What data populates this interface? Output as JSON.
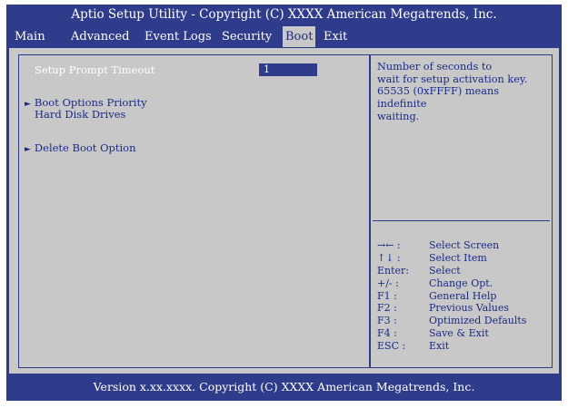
{
  "header": {
    "title": "Aptio Setup Utility - Copyright (C) XXXX American Megatrends, Inc."
  },
  "tabs": [
    {
      "label": "Main"
    },
    {
      "label": "Advanced"
    },
    {
      "label": "Event Logs"
    },
    {
      "label": "Security"
    },
    {
      "label": "Boot",
      "active": true
    },
    {
      "label": "Exit"
    }
  ],
  "main": {
    "setup_prompt_timeout": {
      "label": "Setup Prompt Timeout",
      "value": "1"
    },
    "boot_options_priority": {
      "label": "Boot Options Priority"
    },
    "hard_disk_drives": {
      "label": "Hard Disk Drives"
    },
    "delete_boot_option": {
      "label": "Delete Boot Option"
    },
    "submenu_marker": "►"
  },
  "help": {
    "lines": [
      "Number of seconds to",
      "wait for setup activation key.",
      "65535 (0xFFFF) means indefinite",
      "waiting."
    ]
  },
  "keys": [
    {
      "key": "→← :",
      "desc": "Select Screen"
    },
    {
      "key": "↑↓  :",
      "desc": "Select Item"
    },
    {
      "key": "Enter:",
      "desc": "Select"
    },
    {
      "key": "+/- :",
      "desc": "Change Opt."
    },
    {
      "key": "F1 :",
      "desc": "General Help"
    },
    {
      "key": "F2 :",
      "desc": "Previous Values"
    },
    {
      "key": "F3 :",
      "desc": "Optimized Defaults"
    },
    {
      "key": "F4 :",
      "desc": "Save & Exit"
    },
    {
      "key": "ESC :",
      "desc": "Exit"
    }
  ],
  "footer": {
    "text": "Version x.xx.xxxx. Copyright (C) XXXX American Megatrends, Inc."
  },
  "colors": {
    "frame": "#2f3c8b",
    "panel": "#c8c8c8",
    "text_blue": "#1b2a88",
    "highlight": "#ffffff"
  }
}
